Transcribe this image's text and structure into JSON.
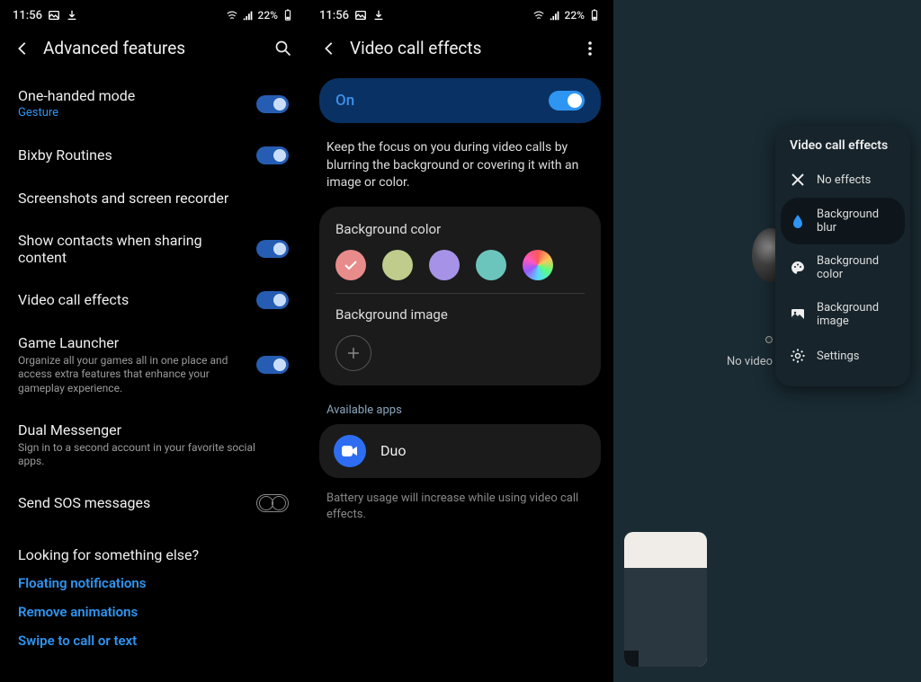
{
  "status": {
    "time": "11:56",
    "battery": "22%"
  },
  "panel1": {
    "title": "Advanced features",
    "items": [
      {
        "title": "One-handed mode",
        "sub": "Gesture",
        "subBlue": true,
        "toggle": "on"
      },
      {
        "title": "Bixby Routines",
        "toggle": "on"
      },
      {
        "title": "Screenshots and screen recorder"
      },
      {
        "title": "Show contacts when sharing content",
        "toggle": "on"
      },
      {
        "title": "Video call effects",
        "toggle": "on"
      },
      {
        "title": "Game Launcher",
        "sub": "Organize all your games all in one place and access extra features that enhance your gameplay experience.",
        "toggle": "on"
      },
      {
        "title": "Dual Messenger",
        "sub": "Sign in to a second account in your favorite social apps."
      },
      {
        "title": "Send SOS messages",
        "toggle": "dual"
      }
    ],
    "lookingHeading": "Looking for something else?",
    "links": [
      "Floating notifications",
      "Remove animations",
      "Swipe to call or text"
    ]
  },
  "panel2": {
    "title": "Video call effects",
    "onLabel": "On",
    "desc": "Keep the focus on you during video calls by blurring the background or covering it with an image or color.",
    "bgColorLabel": "Background color",
    "bgImageLabel": "Background image",
    "availableLabel": "Available apps",
    "app": "Duo",
    "footnote": "Battery usage will increase while using video call effects."
  },
  "panel3": {
    "popupTitle": "Video call effects",
    "items": [
      {
        "label": "No effects",
        "icon": "x"
      },
      {
        "label": "Background blur",
        "icon": "blur",
        "selected": true
      },
      {
        "label": "Background color",
        "icon": "color"
      },
      {
        "label": "Background image",
        "icon": "image"
      },
      {
        "label": "Settings",
        "icon": "gear"
      }
    ],
    "noVideo": "No video"
  }
}
